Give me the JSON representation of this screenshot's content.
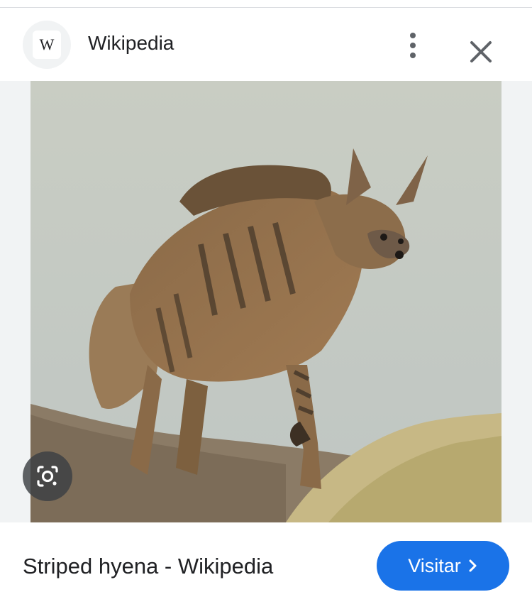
{
  "header": {
    "favicon_letter": "W",
    "site_name": "Wikipedia",
    "more_icon": "more-vert-icon",
    "close_icon": "close-icon"
  },
  "image": {
    "subject": "striped hyena",
    "lens_icon": "google-lens-icon"
  },
  "footer": {
    "title": "Striped hyena - Wikipedia",
    "visit_label": "Visitar",
    "visit_icon": "chevron-right-icon"
  },
  "colors": {
    "accent": "#1a73e8",
    "text": "#202124",
    "icon": "#5f6368",
    "panel": "#f1f3f4"
  }
}
